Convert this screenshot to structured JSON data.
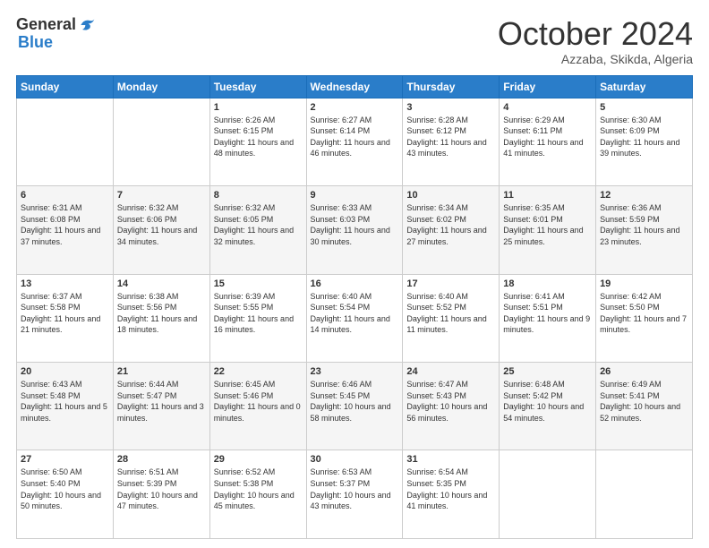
{
  "header": {
    "logo_line1": "General",
    "logo_line2": "Blue",
    "month": "October 2024",
    "location": "Azzaba, Skikda, Algeria"
  },
  "days_of_week": [
    "Sunday",
    "Monday",
    "Tuesday",
    "Wednesday",
    "Thursday",
    "Friday",
    "Saturday"
  ],
  "weeks": [
    [
      {
        "day": "",
        "sunrise": "",
        "sunset": "",
        "daylight": ""
      },
      {
        "day": "",
        "sunrise": "",
        "sunset": "",
        "daylight": ""
      },
      {
        "day": "1",
        "sunrise": "Sunrise: 6:26 AM",
        "sunset": "Sunset: 6:15 PM",
        "daylight": "Daylight: 11 hours and 48 minutes."
      },
      {
        "day": "2",
        "sunrise": "Sunrise: 6:27 AM",
        "sunset": "Sunset: 6:14 PM",
        "daylight": "Daylight: 11 hours and 46 minutes."
      },
      {
        "day": "3",
        "sunrise": "Sunrise: 6:28 AM",
        "sunset": "Sunset: 6:12 PM",
        "daylight": "Daylight: 11 hours and 43 minutes."
      },
      {
        "day": "4",
        "sunrise": "Sunrise: 6:29 AM",
        "sunset": "Sunset: 6:11 PM",
        "daylight": "Daylight: 11 hours and 41 minutes."
      },
      {
        "day": "5",
        "sunrise": "Sunrise: 6:30 AM",
        "sunset": "Sunset: 6:09 PM",
        "daylight": "Daylight: 11 hours and 39 minutes."
      }
    ],
    [
      {
        "day": "6",
        "sunrise": "Sunrise: 6:31 AM",
        "sunset": "Sunset: 6:08 PM",
        "daylight": "Daylight: 11 hours and 37 minutes."
      },
      {
        "day": "7",
        "sunrise": "Sunrise: 6:32 AM",
        "sunset": "Sunset: 6:06 PM",
        "daylight": "Daylight: 11 hours and 34 minutes."
      },
      {
        "day": "8",
        "sunrise": "Sunrise: 6:32 AM",
        "sunset": "Sunset: 6:05 PM",
        "daylight": "Daylight: 11 hours and 32 minutes."
      },
      {
        "day": "9",
        "sunrise": "Sunrise: 6:33 AM",
        "sunset": "Sunset: 6:03 PM",
        "daylight": "Daylight: 11 hours and 30 minutes."
      },
      {
        "day": "10",
        "sunrise": "Sunrise: 6:34 AM",
        "sunset": "Sunset: 6:02 PM",
        "daylight": "Daylight: 11 hours and 27 minutes."
      },
      {
        "day": "11",
        "sunrise": "Sunrise: 6:35 AM",
        "sunset": "Sunset: 6:01 PM",
        "daylight": "Daylight: 11 hours and 25 minutes."
      },
      {
        "day": "12",
        "sunrise": "Sunrise: 6:36 AM",
        "sunset": "Sunset: 5:59 PM",
        "daylight": "Daylight: 11 hours and 23 minutes."
      }
    ],
    [
      {
        "day": "13",
        "sunrise": "Sunrise: 6:37 AM",
        "sunset": "Sunset: 5:58 PM",
        "daylight": "Daylight: 11 hours and 21 minutes."
      },
      {
        "day": "14",
        "sunrise": "Sunrise: 6:38 AM",
        "sunset": "Sunset: 5:56 PM",
        "daylight": "Daylight: 11 hours and 18 minutes."
      },
      {
        "day": "15",
        "sunrise": "Sunrise: 6:39 AM",
        "sunset": "Sunset: 5:55 PM",
        "daylight": "Daylight: 11 hours and 16 minutes."
      },
      {
        "day": "16",
        "sunrise": "Sunrise: 6:40 AM",
        "sunset": "Sunset: 5:54 PM",
        "daylight": "Daylight: 11 hours and 14 minutes."
      },
      {
        "day": "17",
        "sunrise": "Sunrise: 6:40 AM",
        "sunset": "Sunset: 5:52 PM",
        "daylight": "Daylight: 11 hours and 11 minutes."
      },
      {
        "day": "18",
        "sunrise": "Sunrise: 6:41 AM",
        "sunset": "Sunset: 5:51 PM",
        "daylight": "Daylight: 11 hours and 9 minutes."
      },
      {
        "day": "19",
        "sunrise": "Sunrise: 6:42 AM",
        "sunset": "Sunset: 5:50 PM",
        "daylight": "Daylight: 11 hours and 7 minutes."
      }
    ],
    [
      {
        "day": "20",
        "sunrise": "Sunrise: 6:43 AM",
        "sunset": "Sunset: 5:48 PM",
        "daylight": "Daylight: 11 hours and 5 minutes."
      },
      {
        "day": "21",
        "sunrise": "Sunrise: 6:44 AM",
        "sunset": "Sunset: 5:47 PM",
        "daylight": "Daylight: 11 hours and 3 minutes."
      },
      {
        "day": "22",
        "sunrise": "Sunrise: 6:45 AM",
        "sunset": "Sunset: 5:46 PM",
        "daylight": "Daylight: 11 hours and 0 minutes."
      },
      {
        "day": "23",
        "sunrise": "Sunrise: 6:46 AM",
        "sunset": "Sunset: 5:45 PM",
        "daylight": "Daylight: 10 hours and 58 minutes."
      },
      {
        "day": "24",
        "sunrise": "Sunrise: 6:47 AM",
        "sunset": "Sunset: 5:43 PM",
        "daylight": "Daylight: 10 hours and 56 minutes."
      },
      {
        "day": "25",
        "sunrise": "Sunrise: 6:48 AM",
        "sunset": "Sunset: 5:42 PM",
        "daylight": "Daylight: 10 hours and 54 minutes."
      },
      {
        "day": "26",
        "sunrise": "Sunrise: 6:49 AM",
        "sunset": "Sunset: 5:41 PM",
        "daylight": "Daylight: 10 hours and 52 minutes."
      }
    ],
    [
      {
        "day": "27",
        "sunrise": "Sunrise: 6:50 AM",
        "sunset": "Sunset: 5:40 PM",
        "daylight": "Daylight: 10 hours and 50 minutes."
      },
      {
        "day": "28",
        "sunrise": "Sunrise: 6:51 AM",
        "sunset": "Sunset: 5:39 PM",
        "daylight": "Daylight: 10 hours and 47 minutes."
      },
      {
        "day": "29",
        "sunrise": "Sunrise: 6:52 AM",
        "sunset": "Sunset: 5:38 PM",
        "daylight": "Daylight: 10 hours and 45 minutes."
      },
      {
        "day": "30",
        "sunrise": "Sunrise: 6:53 AM",
        "sunset": "Sunset: 5:37 PM",
        "daylight": "Daylight: 10 hours and 43 minutes."
      },
      {
        "day": "31",
        "sunrise": "Sunrise: 6:54 AM",
        "sunset": "Sunset: 5:35 PM",
        "daylight": "Daylight: 10 hours and 41 minutes."
      },
      {
        "day": "",
        "sunrise": "",
        "sunset": "",
        "daylight": ""
      },
      {
        "day": "",
        "sunrise": "",
        "sunset": "",
        "daylight": ""
      }
    ]
  ]
}
